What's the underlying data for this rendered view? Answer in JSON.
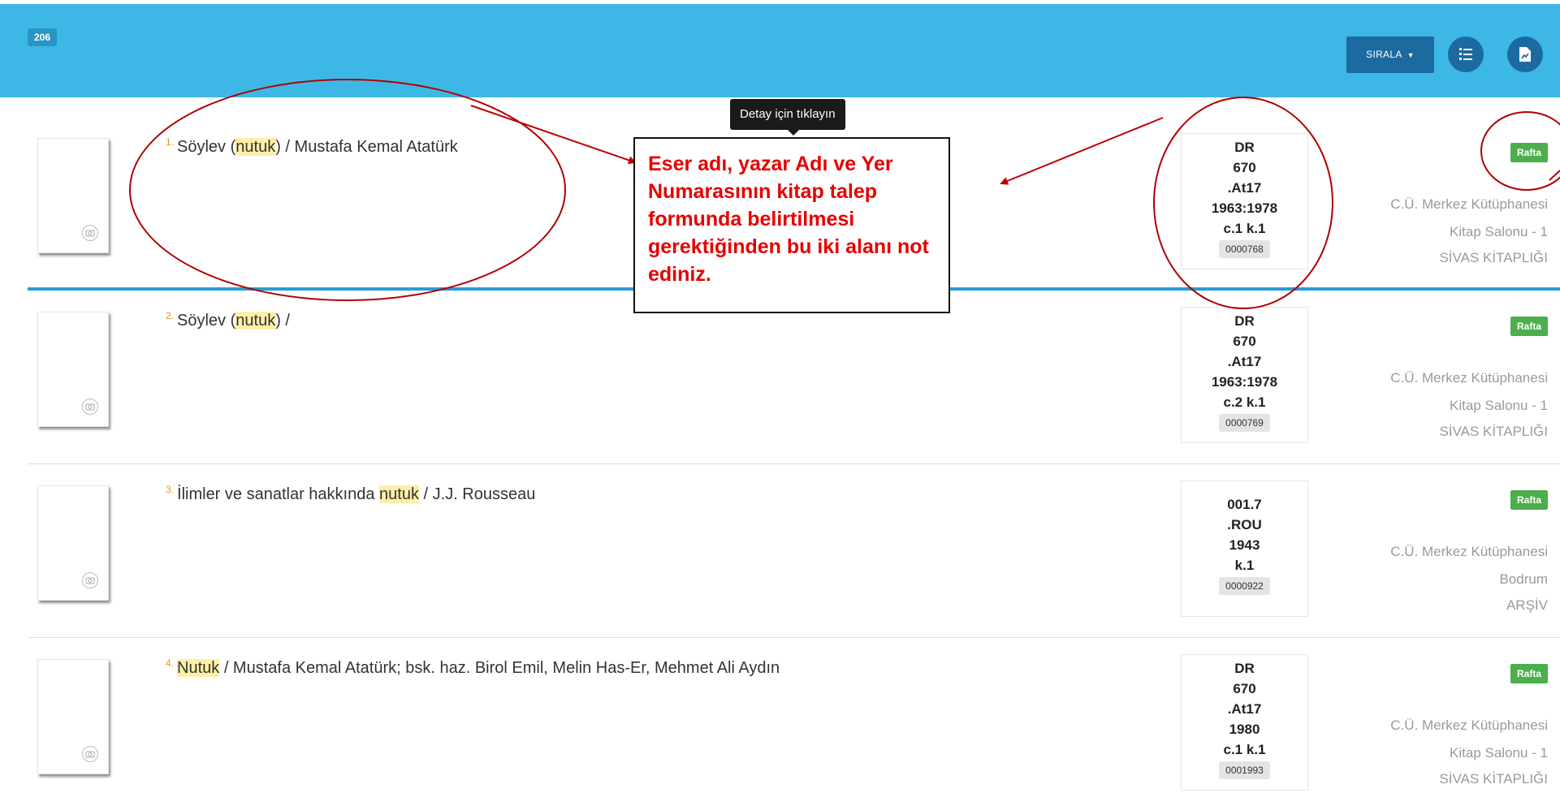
{
  "header": {
    "result_count": "206",
    "sort_label": "SIRALA",
    "colors": {
      "bg": "#3db8e6",
      "button": "#1c6aa0"
    }
  },
  "tooltip": {
    "text": "Detay için tıklayın"
  },
  "annotation": {
    "note": "Eser adı, yazar Adı ve Yer Numarasının kitap talep formunda belirtilmesi gerektiğinden bu iki alanı not ediniz."
  },
  "results": [
    {
      "number": "1.",
      "title_before": "Söylev (",
      "title_highlight": "nutuk",
      "title_after": ") / Mustafa Kemal Atatürk",
      "call_number": [
        "DR",
        "670",
        ".At17",
        "1963:1978",
        "c.1 k.1"
      ],
      "barcode": "0000768",
      "status": "Rafta",
      "location": [
        "C.Ü. Merkez Kütüphanesi",
        "Kitap Salonu - 1",
        "SİVAS KİTAPLIĞI"
      ]
    },
    {
      "number": "2.",
      "title_before": "Söylev (",
      "title_highlight": "nutuk",
      "title_after": ") /",
      "call_number": [
        "DR",
        "670",
        ".At17",
        "1963:1978",
        "c.2 k.1"
      ],
      "barcode": "0000769",
      "status": "Rafta",
      "location": [
        "C.Ü. Merkez Kütüphanesi",
        "Kitap Salonu - 1",
        "SİVAS KİTAPLIĞI"
      ]
    },
    {
      "number": "3.",
      "title_before": "İlimler ve sanatlar hakkında ",
      "title_highlight": "nutuk",
      "title_after": " / J.J. Rousseau",
      "call_number": [
        "001.7",
        ".ROU",
        "1943",
        "k.1"
      ],
      "barcode": "0000922",
      "status": "Rafta",
      "location": [
        "C.Ü. Merkez Kütüphanesi",
        "Bodrum",
        "ARŞİV"
      ]
    },
    {
      "number": "4.",
      "title_before": "",
      "title_highlight": "Nutuk",
      "title_after": " / Mustafa Kemal Atatürk; bsk. haz. Birol Emil, Melin Has-Er, Mehmet Ali Aydın",
      "call_number": [
        "DR",
        "670",
        ".At17",
        "1980",
        "c.1 k.1"
      ],
      "barcode": "0001993",
      "status": "Rafta",
      "location": [
        "C.Ü. Merkez Kütüphanesi",
        "Kitap Salonu - 1",
        "SİVAS KİTAPLIĞI"
      ]
    }
  ]
}
